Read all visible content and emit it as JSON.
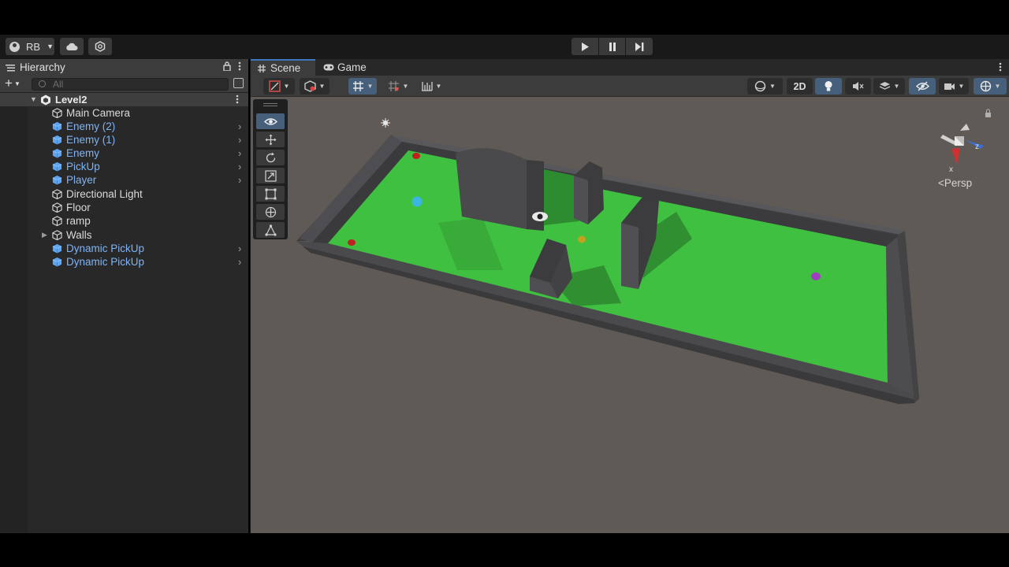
{
  "toolbar": {
    "account_label": "RB",
    "play_controls": [
      "play-icon",
      "pause-icon",
      "step-icon"
    ]
  },
  "hierarchy": {
    "tab_title": "Hierarchy",
    "search_placeholder": "All",
    "scene_name": "Level2",
    "items": [
      {
        "label": "Main Camera",
        "type": "gameobject",
        "expandable": false
      },
      {
        "label": "Enemy (2)",
        "type": "prefab",
        "expandable": true
      },
      {
        "label": "Enemy (1)",
        "type": "prefab",
        "expandable": true
      },
      {
        "label": "Enemy",
        "type": "prefab",
        "expandable": true
      },
      {
        "label": "PickUp",
        "type": "prefab",
        "expandable": true
      },
      {
        "label": "Player",
        "type": "prefab",
        "expandable": true
      },
      {
        "label": "Directional Light",
        "type": "gameobject",
        "expandable": false
      },
      {
        "label": "Floor",
        "type": "gameobject",
        "expandable": false
      },
      {
        "label": "ramp",
        "type": "gameobject",
        "expandable": false
      },
      {
        "label": "Walls",
        "type": "gameobject",
        "foldout": true
      },
      {
        "label": "Dynamic PickUp",
        "type": "prefab",
        "expandable": true
      },
      {
        "label": "Dynamic PickUp",
        "type": "prefab",
        "expandable": true
      }
    ]
  },
  "scene_view": {
    "tabs": [
      {
        "label": "Scene",
        "active": true
      },
      {
        "label": "Game",
        "active": false
      }
    ],
    "toggle_2d_label": "2D",
    "projection_label": "Persp",
    "gizmo_axes": {
      "y": "y",
      "z": "z",
      "x": "x"
    },
    "tools": [
      "view-tool",
      "move-tool",
      "rotate-tool",
      "scale-tool",
      "rect-tool",
      "transform-tool",
      "custom-tool"
    ],
    "selected_tool": "view-tool"
  },
  "colors": {
    "accent_blue": "#46607c",
    "prefab_text": "#7fb3f5",
    "floor_green": "#3fc040",
    "wall_gray": "#4a4a4d",
    "scene_bg": "#5f5a55"
  }
}
